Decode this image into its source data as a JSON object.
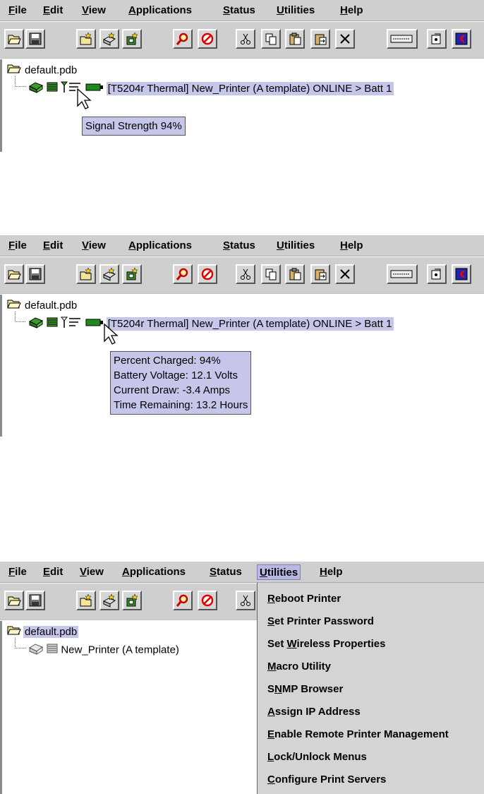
{
  "menubar": {
    "items": [
      {
        "key": "F",
        "rest": "ile",
        "label": "File"
      },
      {
        "key": "E",
        "rest": "dit",
        "label": "Edit"
      },
      {
        "key": "V",
        "rest": "iew",
        "label": "View"
      },
      {
        "key": "A",
        "rest": "pplications",
        "label": "Applications"
      },
      {
        "key": "S",
        "rest": "tatus",
        "label": "Status"
      },
      {
        "key": "U",
        "rest": "tilities",
        "label": "Utilities"
      },
      {
        "key": "H",
        "rest": "elp",
        "label": "Help"
      }
    ]
  },
  "tree": {
    "root_label": "default.pdb",
    "printer_label": "[T5204r Thermal] New_Printer (A template) ONLINE > Batt 1",
    "printer_label_short": "New_Printer (A template)"
  },
  "tooltips": {
    "signal": "Signal Strength 94%",
    "battery": [
      "Percent Charged: 94%",
      "Battery Voltage: 12.1 Volts",
      "Current Draw: -3.4 Amps",
      "Time Remaining: 13.2 Hours"
    ]
  },
  "utilities_menu": {
    "items": [
      {
        "pre": "",
        "key": "R",
        "post": "eboot Printer"
      },
      {
        "pre": "",
        "key": "S",
        "post": "et Printer Password"
      },
      {
        "pre": "Set ",
        "key": "W",
        "post": "ireless Properties"
      },
      {
        "pre": "",
        "key": "M",
        "post": "acro Utility"
      },
      {
        "pre": "S",
        "key": "N",
        "post": "MP Browser"
      },
      {
        "pre": "",
        "key": "A",
        "post": "ssign IP Address"
      },
      {
        "pre": "",
        "key": "E",
        "post": "nable Remote Printer Management"
      },
      {
        "pre": "",
        "key": "L",
        "post": "ock/Unlock Menus"
      },
      {
        "pre": "",
        "key": "C",
        "post": "onfigure Print Servers"
      }
    ]
  },
  "colors": {
    "menubar_bg": "#cfcfcf",
    "selection_bg": "#c6c6ea",
    "printer_green": "#3d9a2a"
  }
}
